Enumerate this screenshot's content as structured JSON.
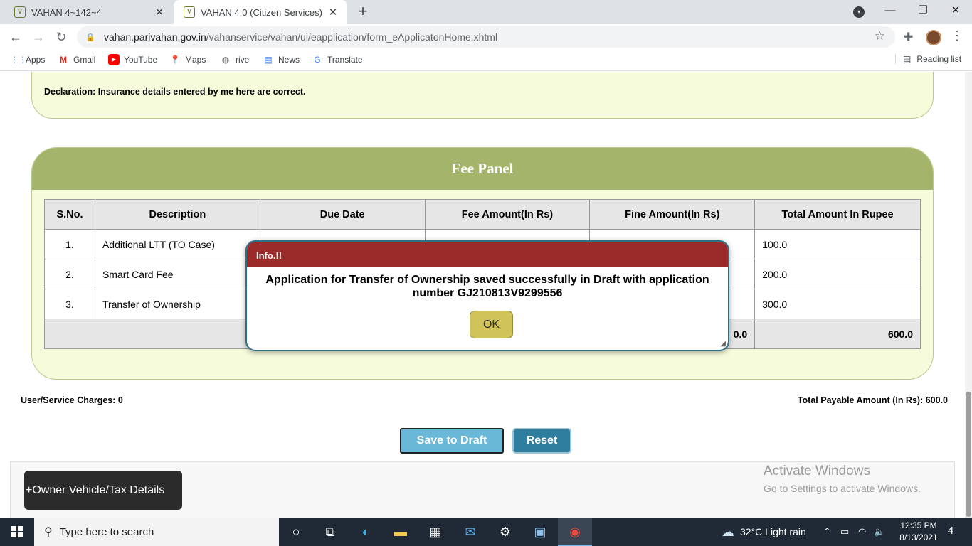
{
  "browser": {
    "tabs": [
      {
        "title": "VAHAN 4~142~4",
        "active": false
      },
      {
        "title": "VAHAN 4.0 (Citizen Services)",
        "active": true
      }
    ],
    "url_host": "vahan.parivahan.gov.in",
    "url_path": "/vahanservice/vahan/ui/eapplication/form_eApplicatonHome.xhtml",
    "bookmarks": [
      "Apps",
      "Gmail",
      "YouTube",
      "Maps",
      "rive",
      "News",
      "Translate"
    ],
    "reading_list": "Reading list"
  },
  "declaration": "Declaration: Insurance details entered by me here are correct.",
  "fee_panel": {
    "title": "Fee Panel",
    "columns": [
      "S.No.",
      "Description",
      "Due Date",
      "Fee Amount(In Rs)",
      "Fine Amount(In Rs)",
      "Total Amount In Rupee"
    ],
    "rows": [
      {
        "sno": "1.",
        "description": "Additional LTT (TO Case)",
        "due_date": "",
        "fee": "",
        "fine": "",
        "total": "100.0"
      },
      {
        "sno": "2.",
        "description": "Smart Card Fee",
        "due_date": "",
        "fee": "",
        "fine": "",
        "total": "200.0"
      },
      {
        "sno": "3.",
        "description": "Transfer of Ownership",
        "due_date": "",
        "fee": "",
        "fine": "",
        "total": "300.0"
      }
    ],
    "totals": {
      "fine": "0.0",
      "total": "600.0"
    }
  },
  "user_charges": "User/Service Charges: 0",
  "total_payable": "Total Payable Amount (In Rs): 600.0",
  "buttons": {
    "save_draft": "Save to Draft",
    "reset": "Reset"
  },
  "owner_details_button": "+Owner Vehicle/Tax Details",
  "activate_windows": {
    "line1": "Activate Windows",
    "line2": "Go to Settings to activate Windows."
  },
  "modal": {
    "header": "Info.!!",
    "line1": "Application for Transfer of Ownership saved successfully in Draft with application",
    "line2": "number GJ210813V9299556",
    "ok": "OK"
  },
  "taskbar": {
    "search_placeholder": "Type here to search",
    "weather": "32°C  Light rain",
    "time": "12:35 PM",
    "date": "8/13/2021",
    "notifications": "4"
  },
  "colors": {
    "fee_header": "#a3b56a",
    "panel_bg": "#f6fbdc",
    "modal_header": "#9b2b2b",
    "ok_button": "#cfc35a",
    "save_button": "#6ab8d8",
    "reset_button": "#2e7ea0"
  }
}
